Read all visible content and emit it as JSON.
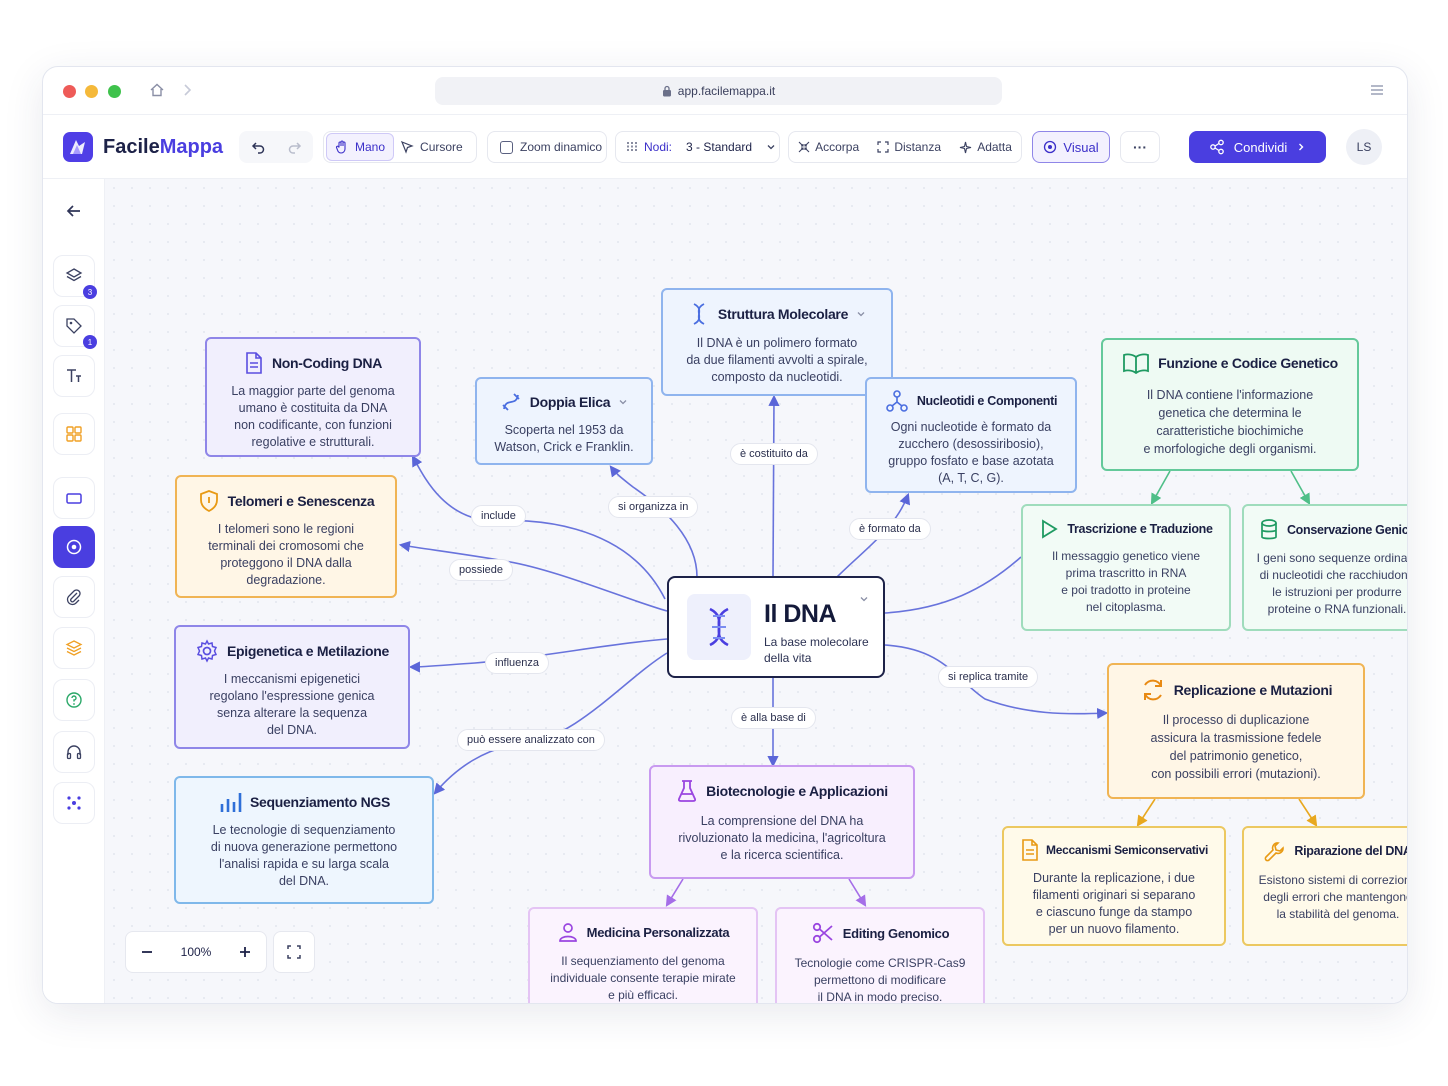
{
  "browser": {
    "url": "app.facilemappa.it"
  },
  "app": {
    "name_part1": "Facile",
    "name_part2": "Mappa"
  },
  "toolbar": {
    "hand": "Mano",
    "cursor": "Cursore",
    "dynamic_zoom": "Zoom dinamico",
    "nodes_label": "Nodi:",
    "nodes_value": "3 - Standard",
    "collapse": "Accorpa",
    "distance": "Distanza",
    "fit": "Adatta",
    "visual": "Visual",
    "more": "···",
    "share": "Condividi",
    "avatar": "LS"
  },
  "sidebar": {
    "badge1": "3",
    "badge2": "1"
  },
  "center": {
    "title": "Il DNA",
    "subtitle_l1": "La base molecolare",
    "subtitle_l2": "della vita"
  },
  "nodes": {
    "struttura": {
      "title": "Struttura Molecolare",
      "lines": [
        "Il DNA è un polimero formato",
        "da due filamenti avvolti a spirale,",
        "composto da nucleotidi."
      ]
    },
    "noncoding": {
      "title": "Non-Coding DNA",
      "lines": [
        "La maggior parte del genoma",
        "umano è costituita da DNA",
        "non codificante, con funzioni",
        "regolative e strutturali."
      ]
    },
    "doppia": {
      "title": "Doppia Elica",
      "lines": [
        "Scoperta nel 1953 da",
        "Watson, Crick e Franklin."
      ]
    },
    "nucleotidi": {
      "title": "Nucleotidi e Componenti",
      "lines": [
        "Ogni nucleotide è formato da",
        "zucchero (desossiribosio),",
        "gruppo fosfato e base azotata",
        "(A, T, C, G)."
      ]
    },
    "funzione": {
      "title": "Funzione e Codice Genetico",
      "lines": [
        "Il DNA contiene l'informazione",
        "genetica che determina le",
        "caratteristiche biochimiche",
        "e morfologiche degli organismi."
      ]
    },
    "telomeri": {
      "title": "Telomeri e Senescenza",
      "lines": [
        "I telomeri sono le regioni",
        "terminali dei cromosomi che",
        "proteggono il DNA dalla",
        "degradazione."
      ]
    },
    "trascrizione": {
      "title": "Trascrizione e Traduzione",
      "lines": [
        "Il messaggio genetico viene",
        "prima trascritto in RNA",
        "e poi tradotto in proteine",
        "nel citoplasma."
      ]
    },
    "conservazione": {
      "title": "Conservazione Genica",
      "lines": [
        "I geni sono sequenze ordinate",
        "di nucleotidi che racchiudono",
        "le istruzioni per produrre",
        "proteine o RNA funzionali."
      ]
    },
    "epigenetica": {
      "title": "Epigenetica e Metilazione",
      "lines": [
        "I meccanismi epigenetici",
        "regolano l'espressione genica",
        "senza alterare la sequenza",
        "del DNA."
      ]
    },
    "replicazione": {
      "title": "Replicazione e Mutazioni",
      "lines": [
        "Il processo di duplicazione",
        "assicura la trasmissione fedele",
        "del patrimonio genetico,",
        "con possibili errori (mutazioni)."
      ]
    },
    "sequenziamento": {
      "title": "Sequenziamento NGS",
      "lines": [
        "Le tecnologie di sequenziamento",
        "di nuova generazione permettono",
        "l'analisi rapida e su larga scala",
        "del DNA."
      ]
    },
    "biotecnologie": {
      "title": "Biotecnologie e Applicazioni",
      "lines": [
        "La comprensione del DNA ha",
        "rivoluzionato la medicina, l'agricoltura",
        "e la ricerca scientifica."
      ]
    },
    "semiconservativi": {
      "title": "Meccanismi Semiconservativi",
      "lines": [
        "Durante la replicazione, i due",
        "filamenti originari si separano",
        "e ciascuno funge da stampo",
        "per un nuovo filamento."
      ]
    },
    "riparazione": {
      "title": "Riparazione del DNA",
      "lines": [
        "Esistono sistemi di correzione",
        "degli errori che mantengono",
        "la stabilità del genoma."
      ]
    },
    "medicina": {
      "title": "Medicina Personalizzata",
      "lines": [
        "Il sequenziamento del genoma",
        "individuale consente terapie mirate",
        "e più efficaci."
      ]
    },
    "editing": {
      "title": "Editing Genomico",
      "lines": [
        "Tecnologie come CRISPR-Cas9",
        "permettono di modificare",
        "il DNA in modo preciso."
      ]
    }
  },
  "links": {
    "include": "include",
    "organizza": "si organizza in",
    "costituito": "è costituito da",
    "formato": "è formato da",
    "possiede": "possiede",
    "influenza": "influenza",
    "analizzato": "può essere analizzato con",
    "base": "è alla base di",
    "replica": "si replica tramite"
  },
  "zoom": {
    "value": "100%"
  },
  "colors": {
    "accent": "#4a3ee0",
    "purple_border": "#8f86e8",
    "purple_bg": "#f1effd",
    "blue_border": "#8fb4ee",
    "blue_bg": "#eef4fe",
    "green_border": "#64c99a",
    "green_bg": "#eefaf3",
    "orange_border": "#f0b454",
    "orange_bg": "#fff6e6",
    "violet_border": "#c89af0",
    "violet_bg": "#f8effe",
    "yellow_border": "#ecc860",
    "yellow_bg": "#fffaea"
  }
}
